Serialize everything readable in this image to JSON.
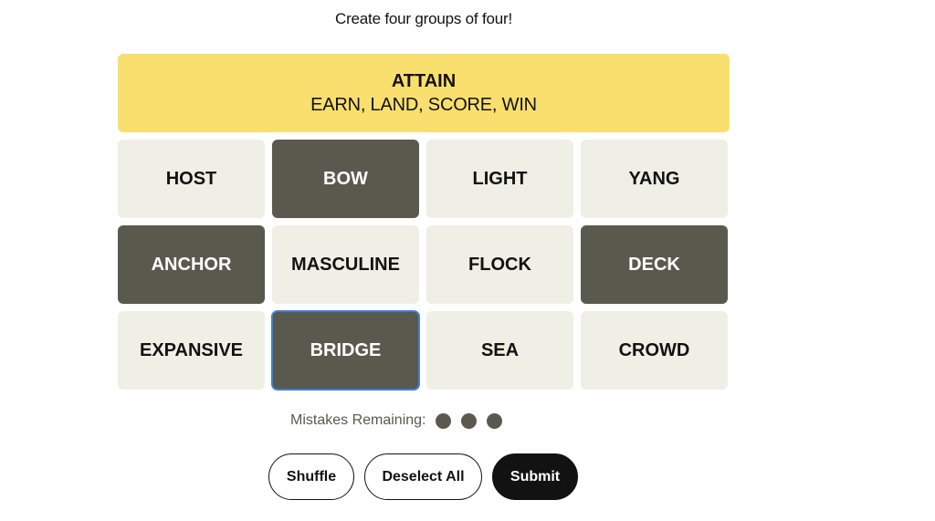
{
  "header": {
    "instructions": "Create four groups of four!"
  },
  "solved_groups": [
    {
      "title": "ATTAIN",
      "members": "EARN, LAND, SCORE, WIN",
      "color": "#f9df6d"
    }
  ],
  "tiles": [
    {
      "word": "HOST",
      "selected": false
    },
    {
      "word": "BOW",
      "selected": true
    },
    {
      "word": "LIGHT",
      "selected": false
    },
    {
      "word": "YANG",
      "selected": false
    },
    {
      "word": "ANCHOR",
      "selected": true
    },
    {
      "word": "MASCULINE",
      "selected": false
    },
    {
      "word": "FLOCK",
      "selected": false
    },
    {
      "word": "DECK",
      "selected": true
    },
    {
      "word": "EXPANSIVE",
      "selected": false
    },
    {
      "word": "BRIDGE",
      "selected": true,
      "focused": true
    },
    {
      "word": "SEA",
      "selected": false
    },
    {
      "word": "CROWD",
      "selected": false
    }
  ],
  "mistakes": {
    "label": "Mistakes Remaining:",
    "remaining": 3
  },
  "controls": {
    "shuffle_label": "Shuffle",
    "deselect_label": "Deselect All",
    "submit_label": "Submit"
  },
  "colors": {
    "tile_default": "#efefe6",
    "tile_selected": "#5a594e",
    "yellow_group": "#f9df6d",
    "focus_outline": "#3d7fd6"
  }
}
